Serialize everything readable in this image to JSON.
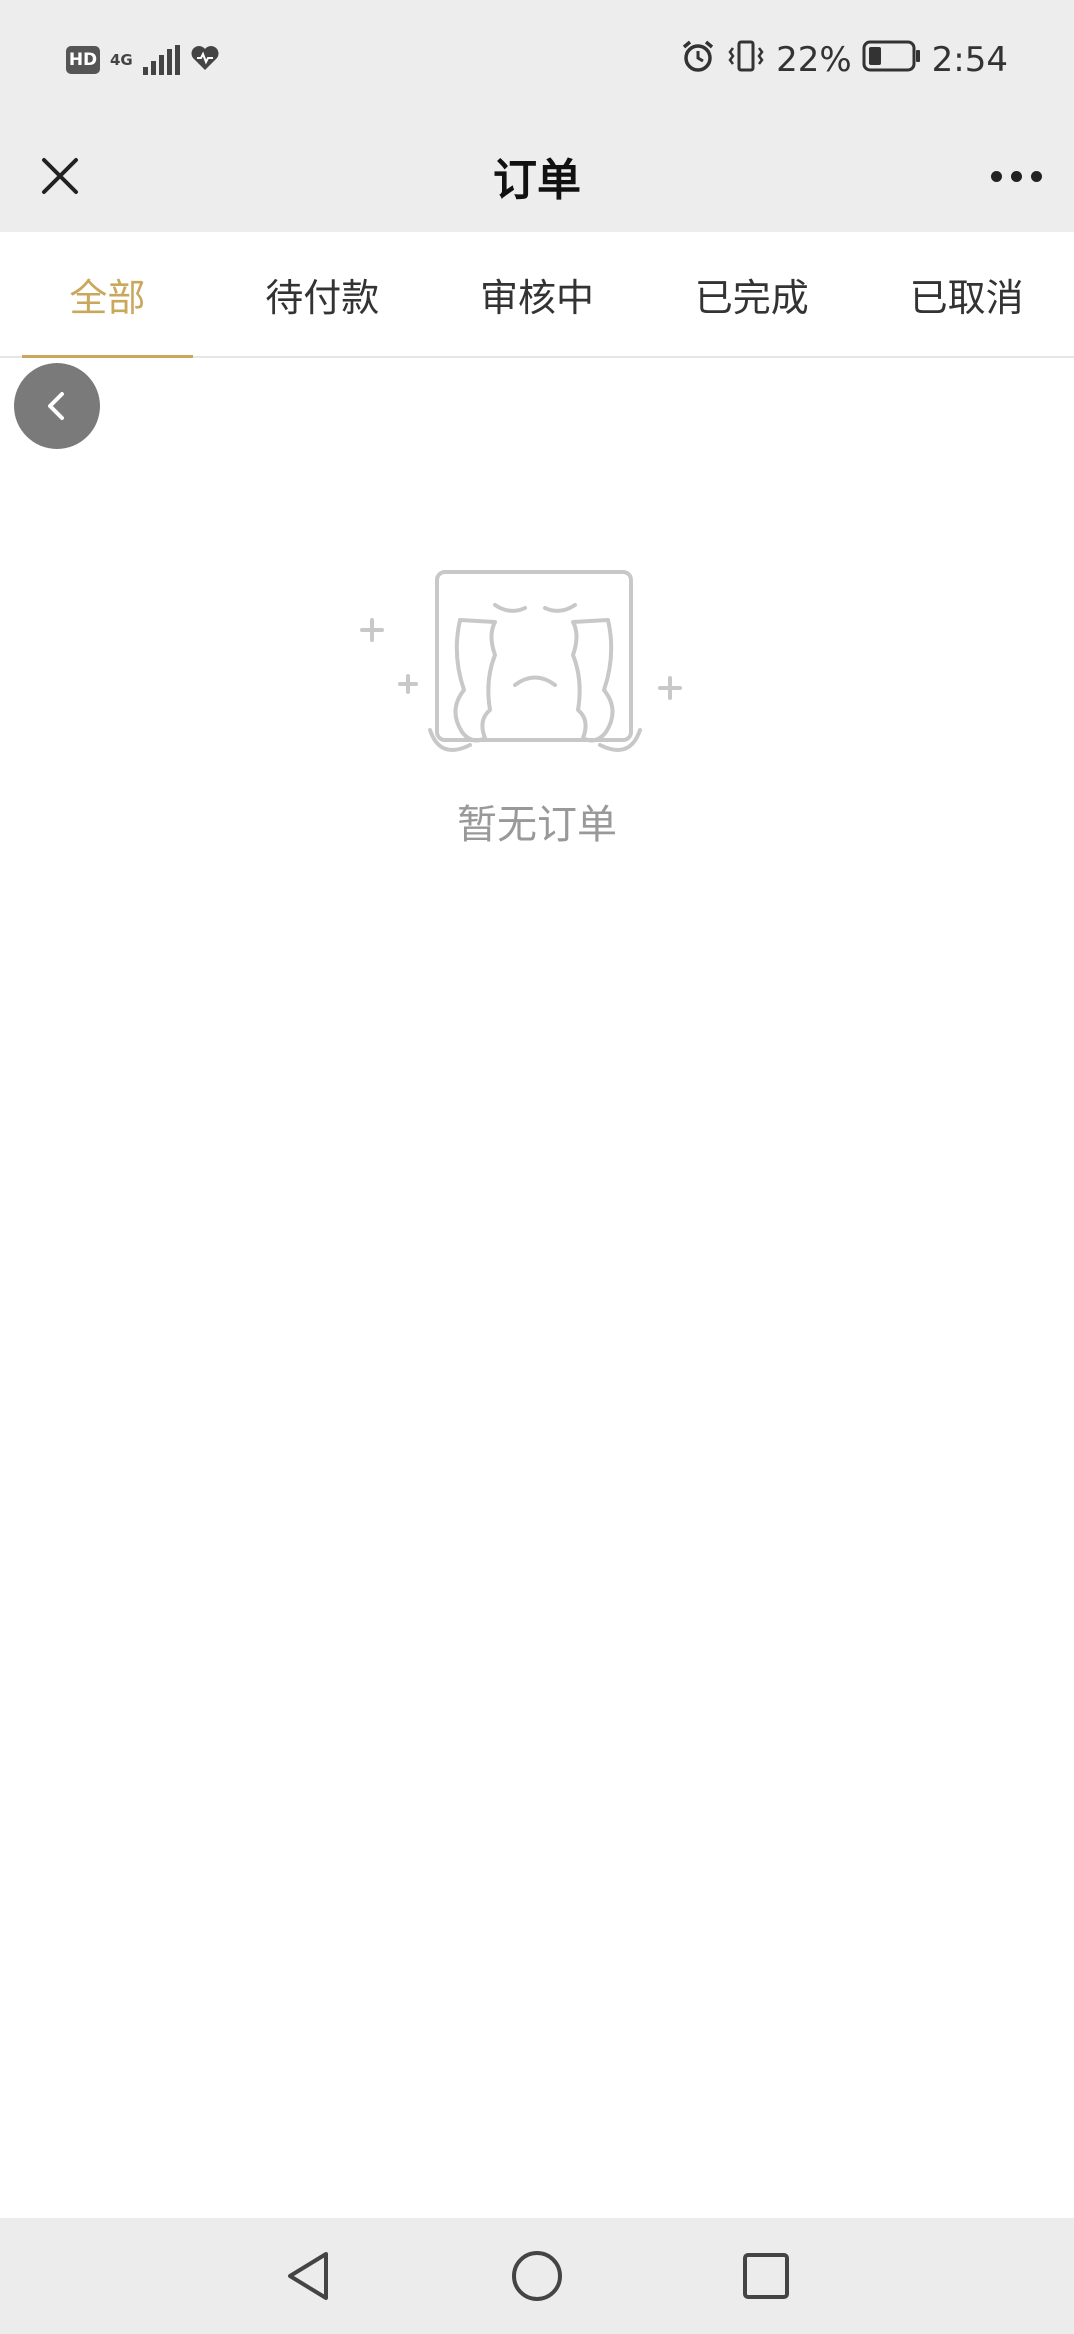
{
  "status_bar": {
    "hd": "HD",
    "network": "4G",
    "battery_percent": "22%",
    "time": "2:54",
    "icons": [
      "hd-icon",
      "signal-icon",
      "heart-icon",
      "alarm-icon",
      "vibrate-icon",
      "battery-icon"
    ]
  },
  "nav": {
    "title": "订单",
    "close_icon": "close-icon",
    "more_icon": "more-icon"
  },
  "tabs": [
    {
      "label": "全部",
      "active": true
    },
    {
      "label": "待付款",
      "active": false
    },
    {
      "label": "审核中",
      "active": false
    },
    {
      "label": "已完成",
      "active": false
    },
    {
      "label": "已取消",
      "active": false
    }
  ],
  "floating_back": {
    "icon": "chevron-left-icon"
  },
  "empty_state": {
    "icon": "empty-box-icon",
    "message": "暂无订单"
  },
  "system_nav": {
    "icons": [
      "back-triangle-icon",
      "home-circle-icon",
      "recents-square-icon"
    ]
  },
  "colors": {
    "accent": "#c9a85c",
    "nav_background": "#ededed",
    "muted_text": "#999999",
    "float_button": "#7a7a7a"
  }
}
